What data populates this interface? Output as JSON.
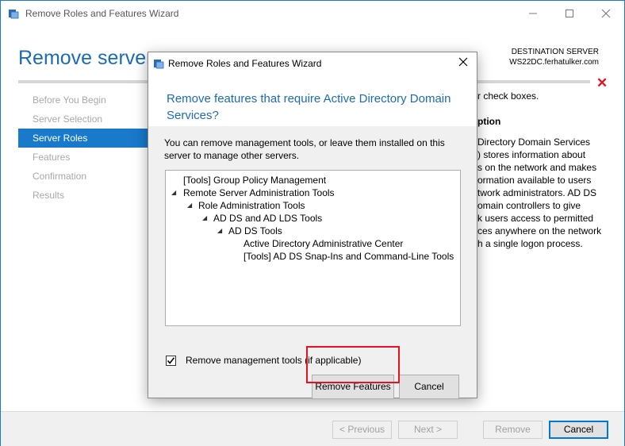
{
  "outer_window": {
    "title": "Remove Roles and Features Wizard",
    "page_title": "Remove server ro",
    "destination_label": "DESTINATION SERVER",
    "destination_server": "WS22DC.ferhatulker.com",
    "error_icon": "close-x-icon",
    "sidebar": [
      {
        "label": "Before You Begin",
        "active": false
      },
      {
        "label": "Server Selection",
        "active": false
      },
      {
        "label": "Server Roles",
        "active": true
      },
      {
        "label": "Features",
        "active": false
      },
      {
        "label": "Confirmation",
        "active": false
      },
      {
        "label": "Results",
        "active": false
      }
    ],
    "right_text_top": "r check boxes.",
    "right_heading": "ption",
    "right_desc_lines": [
      "Directory Domain Services",
      ") stores information about",
      "s on the network and makes",
      "ormation available to users",
      "twork administrators. AD DS",
      "omain controllers to give",
      "k users access to permitted",
      "ces anywhere on the network",
      "h a single logon process."
    ],
    "footer": {
      "previous": "< Previous",
      "next": "Next >",
      "remove": "Remove",
      "cancel": "Cancel"
    }
  },
  "dialog": {
    "title": "Remove Roles and Features Wizard",
    "heading": "Remove features that require Active Directory Domain Services?",
    "description": "You can remove management tools, or leave them installed on this server to manage other servers.",
    "tree": [
      {
        "label": "[Tools] Group Policy Management",
        "indent": 0,
        "expander": false
      },
      {
        "label": "Remote Server Administration Tools",
        "indent": 0,
        "expander": true
      },
      {
        "label": "Role Administration Tools",
        "indent": 1,
        "expander": true
      },
      {
        "label": "AD DS and AD LDS Tools",
        "indent": 2,
        "expander": true
      },
      {
        "label": "AD DS Tools",
        "indent": 3,
        "expander": true
      },
      {
        "label": "Active Directory Administrative Center",
        "indent": 4,
        "expander": false
      },
      {
        "label": "[Tools] AD DS Snap-Ins and Command-Line Tools",
        "indent": 4,
        "expander": false
      }
    ],
    "checkbox_label": "Remove management tools (if applicable)",
    "checkbox_checked": true,
    "remove_features_button": "Remove Features",
    "cancel_button": "Cancel"
  },
  "colors": {
    "accent": "#1979ca",
    "heading_blue": "#1b6cb6",
    "highlight_red": "#e81123"
  }
}
